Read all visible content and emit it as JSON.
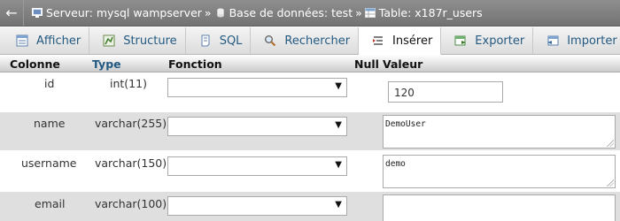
{
  "breadcrumb": {
    "back_glyph": "←",
    "server": "Serveur: mysql wampserver",
    "database": "Base de données: test",
    "table": "Table: x187r_users",
    "separator": "»"
  },
  "tabs": [
    {
      "label": "Afficher",
      "icon": "browse-icon"
    },
    {
      "label": "Structure",
      "icon": "structure-icon"
    },
    {
      "label": "SQL",
      "icon": "sql-icon"
    },
    {
      "label": "Rechercher",
      "icon": "search-icon"
    },
    {
      "label": "Insérer",
      "icon": "insert-icon",
      "active": true
    },
    {
      "label": "Exporter",
      "icon": "export-icon"
    },
    {
      "label": "Importer",
      "icon": "import-icon"
    }
  ],
  "columns": {
    "colonne": "Colonne",
    "type": "Type",
    "fonction": "Fonction",
    "null": "Null",
    "valeur": "Valeur"
  },
  "rows": [
    {
      "name": "id",
      "type": "int(11)",
      "function": "",
      "value": "120"
    },
    {
      "name": "name",
      "type": "varchar(255)",
      "function": "",
      "value": "DemoUser"
    },
    {
      "name": "username",
      "type": "varchar(150)",
      "function": "",
      "value": "demo"
    },
    {
      "name": "email",
      "type": "varchar(100)",
      "function": "",
      "value": ""
    }
  ],
  "colors": {
    "link": "#235a81",
    "row_alt": "#dfdfdf",
    "breadcrumb_bg": "#828282"
  }
}
